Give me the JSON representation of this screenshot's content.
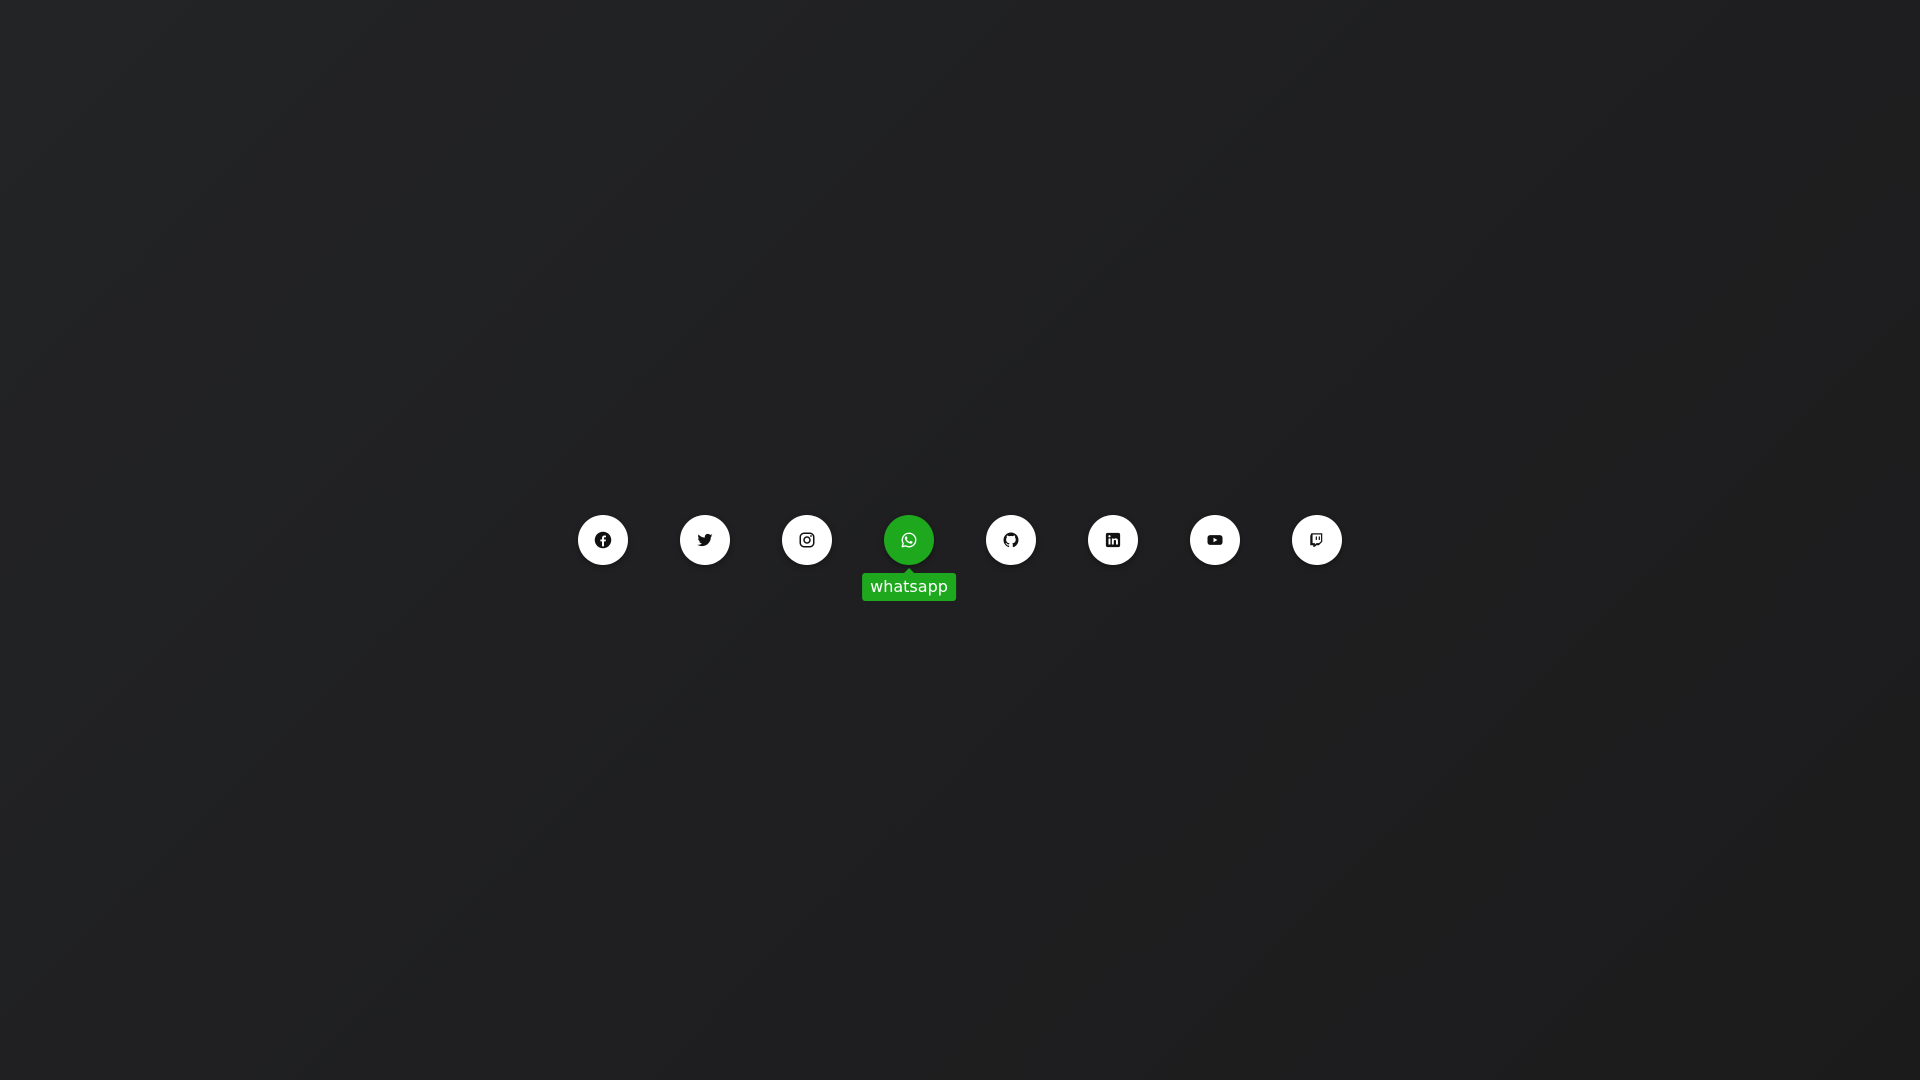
{
  "social": {
    "items": [
      {
        "icon": "facebook-icon",
        "active": false
      },
      {
        "icon": "twitter-icon",
        "active": false
      },
      {
        "icon": "instagram-icon",
        "active": false
      },
      {
        "icon": "whatsapp-icon",
        "active": true
      },
      {
        "icon": "github-icon",
        "active": false
      },
      {
        "icon": "linkedin-icon",
        "active": false
      },
      {
        "icon": "youtube-icon",
        "active": false
      },
      {
        "icon": "twitch-icon",
        "active": false
      }
    ],
    "tooltip": {
      "label": "whatsapp",
      "color": "#1ea81e"
    }
  },
  "colors": {
    "background_start": "#232426",
    "background_end": "#1c1b1c",
    "button": "#ffffff",
    "active": "#1ea81e"
  }
}
